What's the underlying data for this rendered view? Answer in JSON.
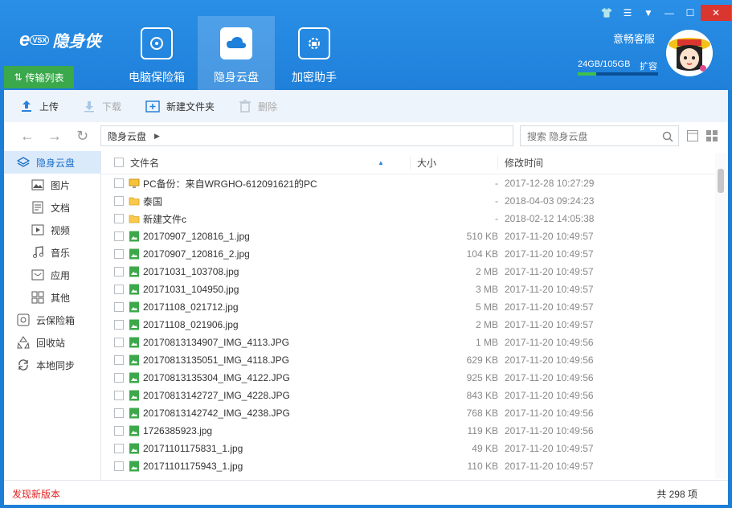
{
  "app": {
    "logo_text": "隐身侠",
    "logo_badge": "VSX",
    "transfer_label": "传输列表",
    "tabs": [
      {
        "label": "电脑保险箱",
        "icon": "safe-icon"
      },
      {
        "label": "隐身云盘",
        "icon": "cloud-icon"
      },
      {
        "label": "加密助手",
        "icon": "gear-lock-icon"
      }
    ],
    "user_name": "意畅客服",
    "quota": "24GB/105GB",
    "quota_fraction": 0.23,
    "expand_label": "扩容",
    "colors": {
      "header": "#1f80da",
      "active_side": "#dbeafa",
      "accent_green": "#3ea84b",
      "close_red": "#d9362f"
    }
  },
  "toolbar": {
    "upload": "上传",
    "download": "下载",
    "new_folder": "新建文件夹",
    "delete": "删除"
  },
  "address": {
    "path": "隐身云盘",
    "search_placeholder": "搜索 隐身云盘"
  },
  "sidebar": {
    "items": [
      {
        "label": "隐身云盘",
        "icon": "layers-icon"
      },
      {
        "label": "图片",
        "icon": "image-icon"
      },
      {
        "label": "文档",
        "icon": "document-icon"
      },
      {
        "label": "视频",
        "icon": "video-icon"
      },
      {
        "label": "音乐",
        "icon": "music-icon"
      },
      {
        "label": "应用",
        "icon": "app-icon"
      },
      {
        "label": "其他",
        "icon": "grid-icon"
      },
      {
        "label": "云保险箱",
        "icon": "cloud-safe-icon"
      },
      {
        "label": "回收站",
        "icon": "recycle-icon"
      },
      {
        "label": "本地同步",
        "icon": "sync-icon"
      }
    ]
  },
  "list": {
    "headers": {
      "name": "文件名",
      "size": "大小",
      "time": "修改时间"
    },
    "rows": [
      {
        "name": "PC备份：来自WRGHO-612091621的PC",
        "size": "-",
        "time": "2017-12-28 10:27:29",
        "type": "pc"
      },
      {
        "name": "泰国",
        "size": "-",
        "time": "2018-04-03 09:24:23",
        "type": "folder"
      },
      {
        "name": "新建文件c",
        "size": "-",
        "time": "2018-02-12 14:05:38",
        "type": "folder"
      },
      {
        "name": "20170907_120816_1.jpg",
        "size": "510 KB",
        "time": "2017-11-20 10:49:57",
        "type": "image"
      },
      {
        "name": "20170907_120816_2.jpg",
        "size": "104 KB",
        "time": "2017-11-20 10:49:57",
        "type": "image"
      },
      {
        "name": "20171031_103708.jpg",
        "size": "2 MB",
        "time": "2017-11-20 10:49:57",
        "type": "image"
      },
      {
        "name": "20171031_104950.jpg",
        "size": "3 MB",
        "time": "2017-11-20 10:49:57",
        "type": "image"
      },
      {
        "name": "20171108_021712.jpg",
        "size": "5 MB",
        "time": "2017-11-20 10:49:57",
        "type": "image"
      },
      {
        "name": "20171108_021906.jpg",
        "size": "2 MB",
        "time": "2017-11-20 10:49:57",
        "type": "image"
      },
      {
        "name": "20170813134907_IMG_4113.JPG",
        "size": "1 MB",
        "time": "2017-11-20 10:49:56",
        "type": "image"
      },
      {
        "name": "20170813135051_IMG_4118.JPG",
        "size": "629 KB",
        "time": "2017-11-20 10:49:56",
        "type": "image"
      },
      {
        "name": "20170813135304_IMG_4122.JPG",
        "size": "925 KB",
        "time": "2017-11-20 10:49:56",
        "type": "image"
      },
      {
        "name": "20170813142727_IMG_4228.JPG",
        "size": "843 KB",
        "time": "2017-11-20 10:49:56",
        "type": "image"
      },
      {
        "name": "20170813142742_IMG_4238.JPG",
        "size": "768 KB",
        "time": "2017-11-20 10:49:56",
        "type": "image"
      },
      {
        "name": "1726385923.jpg",
        "size": "119 KB",
        "time": "2017-11-20 10:49:56",
        "type": "image"
      },
      {
        "name": "20171101175831_1.jpg",
        "size": "49 KB",
        "time": "2017-11-20 10:49:57",
        "type": "image"
      },
      {
        "name": "20171101175943_1.jpg",
        "size": "110 KB",
        "time": "2017-11-20 10:49:57",
        "type": "image"
      }
    ]
  },
  "status": {
    "new_version": "发现新版本",
    "count": "共 298 项"
  }
}
